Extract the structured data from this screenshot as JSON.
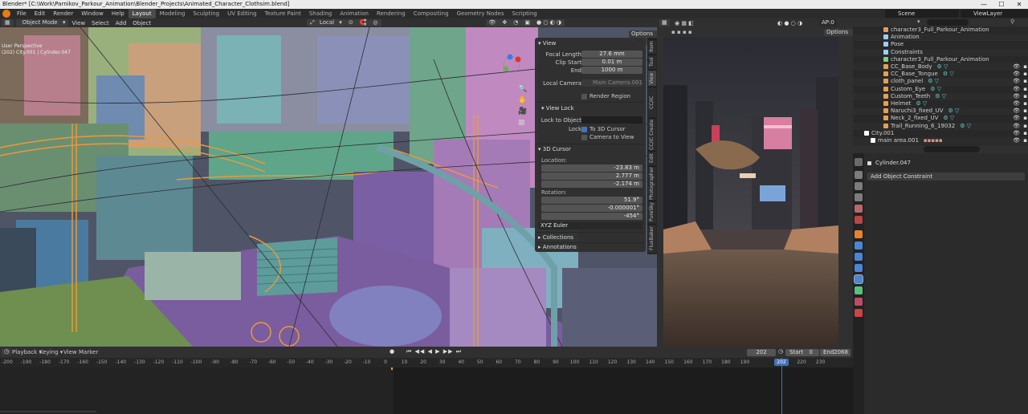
{
  "window": {
    "title": "Blender* [C:\\Work\\Parnikov_Parkour_Animation\\Blender_Projects\\Animated_Character_Clothsim.blend]",
    "controls": [
      "—",
      "☐",
      "✕"
    ]
  },
  "menu": [
    "File",
    "Edit",
    "Render",
    "Window",
    "Help"
  ],
  "workspaces": [
    "Layout",
    "Modeling",
    "Sculpting",
    "UV Editing",
    "Texture Paint",
    "Shading",
    "Animation",
    "Rendering",
    "Compositing",
    "Geometry Nodes",
    "Scripting"
  ],
  "active_workspace": "Layout",
  "scene": "Scene",
  "view_layer": "ViewLayer",
  "viewport_header": {
    "mode": "Object Mode",
    "menus": [
      "View",
      "Select",
      "Add",
      "Object"
    ],
    "transform_space": "Local",
    "options": "Options"
  },
  "viewport_overlay": {
    "view_name": "User Perspective",
    "object_path": "(202) City.001 | Cylinder.047"
  },
  "npanel": {
    "view_section": "View",
    "focal_length_label": "Focal Length",
    "focal_length": "27.6 mm",
    "clip_start_label": "Clip Start",
    "clip_start": "0.01 m",
    "end_label": "End",
    "end": "1000 m",
    "local_camera_label": "Local Camera",
    "local_camera": "Main Camera.001",
    "render_region": "Render Region",
    "view_lock_section": "View Lock",
    "lock_to_object_label": "Lock to Object",
    "lock_label": "Lock",
    "to_3d_cursor": "To 3D Cursor",
    "camera_to_view": "Camera to View",
    "cursor_section": "3D Cursor",
    "location_label": "Location:",
    "loc_x": "-23.83 m",
    "loc_y": "2.777 m",
    "loc_z": "-2.174 m",
    "rotation_label": "Rotation:",
    "rot_x": "51.9°",
    "rot_y": "-0.000001°",
    "rot_z": "-454°",
    "rotation_mode": "XYZ Euler",
    "collections_section": "Collections",
    "annotations_section": "Annotations",
    "axis_x": "X",
    "axis_y": "Y",
    "axis_z": "Z"
  },
  "sidebar_tabs": [
    "Item",
    "Tool",
    "View",
    "CC/iC Pipeline",
    "CC/iC Create",
    "Edit",
    "Photographer",
    "PureSky",
    "FluxBaker"
  ],
  "render_header": {
    "samples": "AP:0",
    "options": "Options"
  },
  "outliner": {
    "rows": [
      {
        "name": "character3_Full_Parkour_Animation",
        "indent": 2,
        "color": "#e0a060"
      },
      {
        "name": "Animation",
        "indent": 3,
        "color": "#9ad0ff"
      },
      {
        "name": "Pose",
        "indent": 3,
        "color": "#9ad0ff"
      },
      {
        "name": "Constraints",
        "indent": 3,
        "color": "#9ad0ff"
      },
      {
        "name": "character3_Full_Parkour_Animation",
        "indent": 3,
        "color": "#7fd18a"
      },
      {
        "name": "CC_Base_Body",
        "indent": 3,
        "color": "#e8a050"
      },
      {
        "name": "CC_Base_Tongue",
        "indent": 3,
        "color": "#e8a050"
      },
      {
        "name": "cloth_panel",
        "indent": 3,
        "color": "#e8a050"
      },
      {
        "name": "Custom_Eye",
        "indent": 3,
        "color": "#e8a050"
      },
      {
        "name": "Custom_Teeth",
        "indent": 3,
        "color": "#e8a050"
      },
      {
        "name": "Helmet",
        "indent": 3,
        "color": "#e8a050"
      },
      {
        "name": "Naruchi3_fixed_UV",
        "indent": 3,
        "color": "#e8a050"
      },
      {
        "name": "Neck_2_fixed_UV",
        "indent": 3,
        "color": "#e8a050"
      },
      {
        "name": "Trail_Running_6_19032",
        "indent": 3,
        "color": "#e8a050"
      },
      {
        "name": "City.001",
        "indent": 1,
        "color": "#ffffff"
      },
      {
        "name": "main area.001",
        "indent": 2,
        "color": "#ffffff"
      }
    ]
  },
  "properties": {
    "object_name": "Cylinder.047",
    "add_constraint": "Add Object Constraint"
  },
  "timeline": {
    "menus": [
      "Playback",
      "Keying",
      "View",
      "Marker"
    ],
    "current_frame": "202",
    "start_label": "Start",
    "start": "0",
    "end_label": "End",
    "end": "2068",
    "ticks": [
      "-200",
      "-190",
      "-180",
      "-170",
      "-160",
      "-150",
      "-140",
      "-130",
      "-120",
      "-110",
      "-100",
      "-90",
      "-80",
      "-70",
      "-60",
      "-50",
      "-40",
      "-30",
      "-20",
      "-10",
      "0",
      "10",
      "20",
      "30",
      "40",
      "50",
      "60",
      "70",
      "80",
      "90",
      "100",
      "110",
      "120",
      "130",
      "140",
      "150",
      "160",
      "170",
      "180",
      "190",
      "202",
      "210",
      "220",
      "230"
    ],
    "playhead": "202"
  },
  "colors": {
    "accent": "#4772b3",
    "playhead": "#4772b3",
    "selected_orange": "#e89a3c"
  }
}
